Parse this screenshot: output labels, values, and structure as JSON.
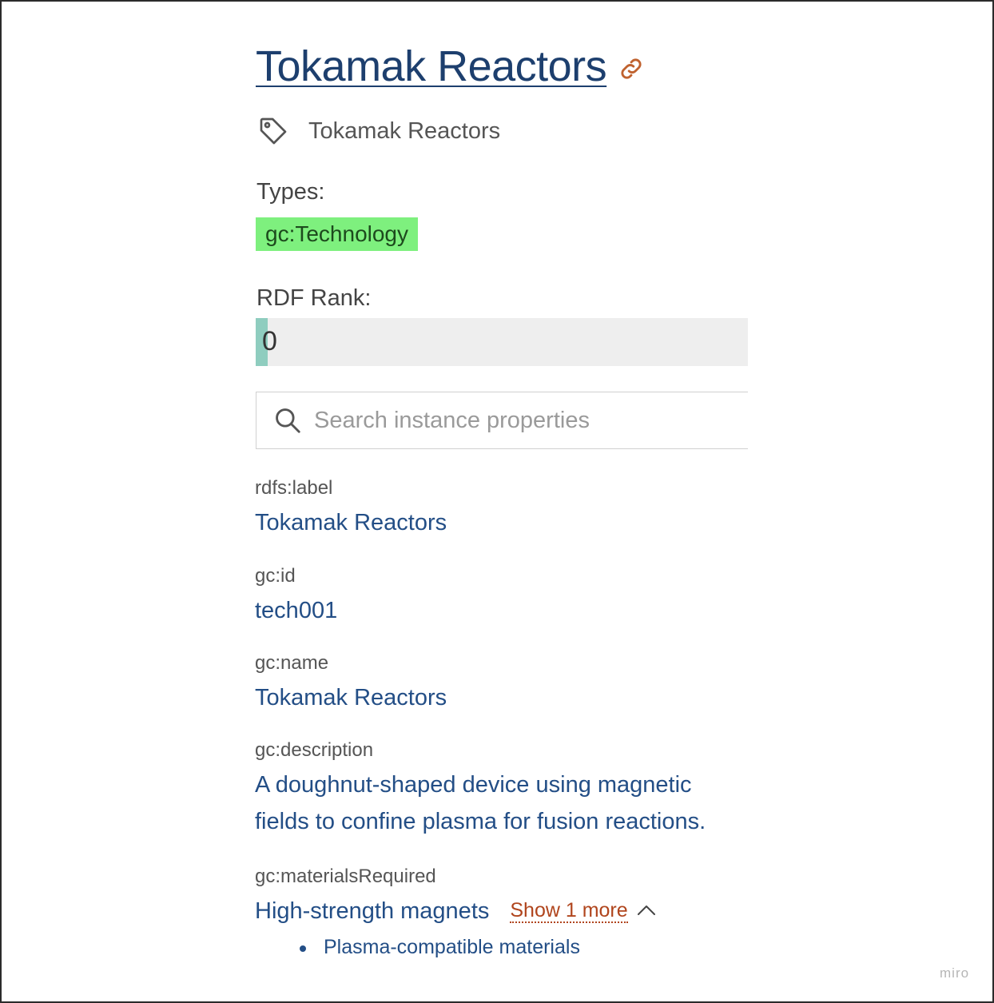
{
  "header": {
    "title": "Tokamak Reactors",
    "label": "Tokamak Reactors"
  },
  "types": {
    "title": "Types:",
    "items": [
      "gc:Technology"
    ]
  },
  "rdf_rank": {
    "title": "RDF Rank:",
    "value": "0"
  },
  "search": {
    "placeholder": "Search instance properties"
  },
  "properties": [
    {
      "key": "rdfs:label",
      "value": "Tokamak Reactors"
    },
    {
      "key": "gc:id",
      "value": "tech001"
    },
    {
      "key": "gc:name",
      "value": "Tokamak Reactors"
    },
    {
      "key": "gc:description",
      "value": "A doughnut-shaped device using magnetic fields to confine plasma for fusion reactions."
    },
    {
      "key": "gc:materialsRequired",
      "value": "High-strength magnets",
      "show_more_label": "Show 1 more",
      "more_values": [
        "Plasma-compatible materials"
      ]
    }
  ],
  "watermark": "miro",
  "colors": {
    "title": "#1d3f6e",
    "value": "#234e86",
    "type_badge": "#7ef07e",
    "rank_fill": "#8fcdbf",
    "show_more": "#b0451d"
  },
  "icons": {
    "title_link": "link-icon",
    "label": "tag-icon",
    "search": "search-icon",
    "collapse": "chevron-up-icon"
  }
}
